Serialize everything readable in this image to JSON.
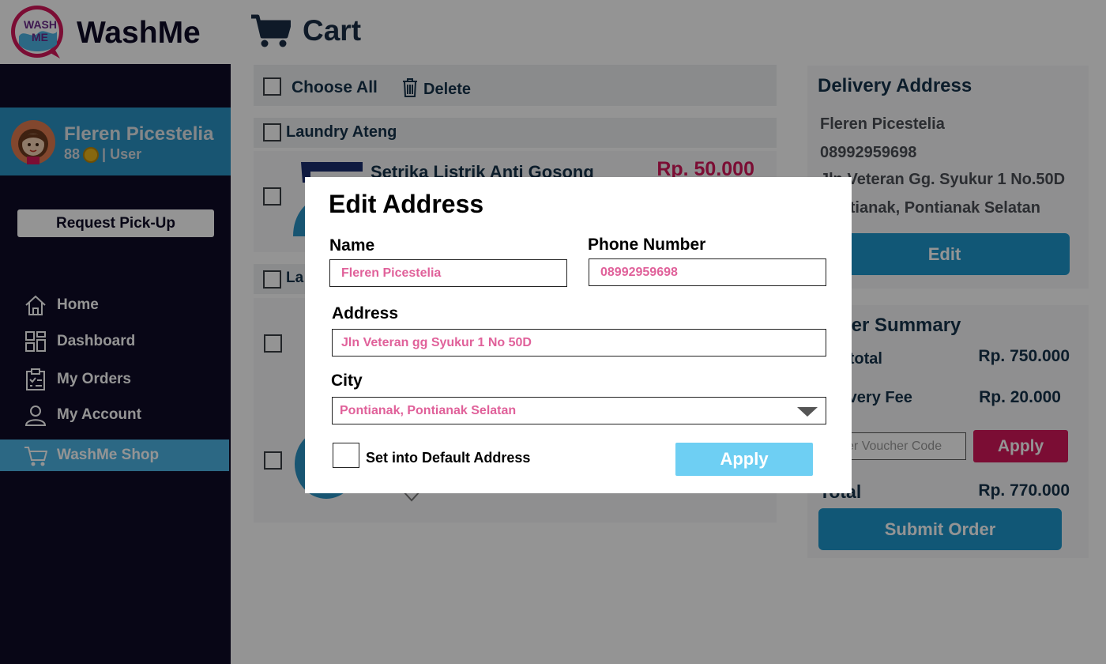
{
  "app": {
    "brand": "WashMe",
    "logo_text": "WASH ME"
  },
  "header": {
    "page_title": "Cart"
  },
  "sidebar": {
    "user_name": "Fleren Picestelia",
    "points": "88",
    "role": "| User",
    "pickup_label": "Request Pick-Up",
    "items": [
      {
        "label": "Home",
        "icon": "home-icon"
      },
      {
        "label": "Dashboard",
        "icon": "dashboard-icon"
      },
      {
        "label": "My Orders",
        "icon": "clipboard-icon"
      },
      {
        "label": "My Account",
        "icon": "user-icon"
      },
      {
        "label": "WashMe Shop",
        "icon": "cart-icon",
        "active": true
      }
    ]
  },
  "cart": {
    "choose_all": "Choose All",
    "delete": "Delete",
    "stores": [
      {
        "name": "Laundry Ateng",
        "items": [
          {
            "name": "Setrika Listrik Anti Gosong",
            "price": "Rp. 50.000"
          }
        ]
      },
      {
        "name": "La"
      }
    ]
  },
  "delivery": {
    "title": "Delivery Address",
    "name": "Fleren Picestelia",
    "phone": "08992959698",
    "address": "Jln Veteran Gg. Syukur 1 No.50D",
    "city": "Pontianak, Pontianak Selatan",
    "edit_label": "Edit"
  },
  "summary": {
    "title": "Order Summary",
    "subtotal_label": "Subtotal",
    "subtotal_value": "Rp. 750.000",
    "delivery_fee_label": "Delivery Fee",
    "delivery_fee_value": "Rp. 20.000",
    "voucher_placeholder": "Enter Voucher Code",
    "apply_label": "Apply",
    "total_label": "Total",
    "total_value": "Rp. 770.000",
    "submit_label": "Submit Order"
  },
  "modal": {
    "title": "Edit Address",
    "name_label": "Name",
    "name_value": "Fleren Picestelia",
    "phone_label": "Phone Number",
    "phone_value": "08992959698",
    "address_label": "Address",
    "address_value": "Jln Veteran gg Syukur 1 No 50D",
    "city_label": "City",
    "city_value": "Pontianak, Pontianak Selatan",
    "default_label": "Set into Default Address",
    "apply_label": "Apply"
  },
  "colors": {
    "sidebar_bg": "#0e0b26",
    "accent_blue": "#1e96cc",
    "accent_pink": "#d4185a",
    "active_nav": "#4cb4e4",
    "input_text": "#e0619a"
  }
}
